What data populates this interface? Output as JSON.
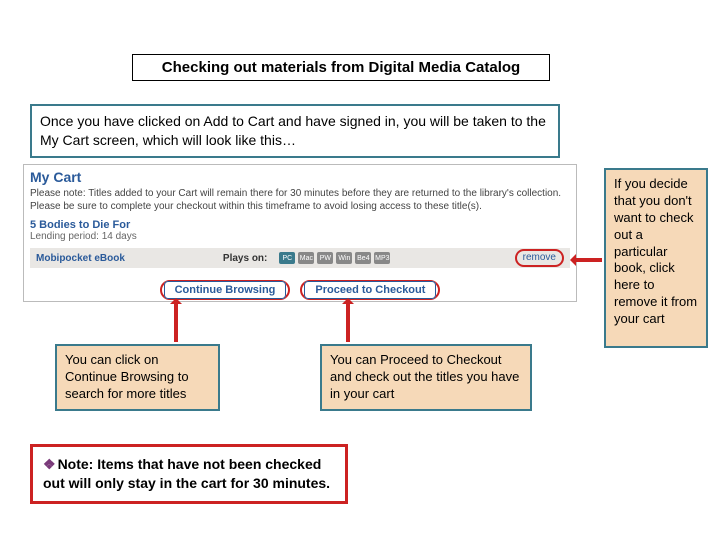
{
  "title": "Checking out materials from Digital Media Catalog",
  "intro": "Once you have clicked on Add to Cart and have signed in, you will be taken to the My Cart screen, which will look like this…",
  "cart": {
    "heading": "My Cart",
    "note": "Please note: Titles added to your Cart will remain there for 30 minutes before they are returned to the library's collection. Please be sure to complete your checkout within this timeframe to avoid losing access to these title(s).",
    "item_title": "5 Bodies to Die For",
    "lending_period": "Lending period: 14 days",
    "format_label": "Mobipocket eBook",
    "plays_on_label": "Plays on:",
    "badges": [
      "PC",
      "Mac",
      "PW",
      "Win",
      "Be4",
      "MP3"
    ],
    "remove_label": "remove",
    "continue_label": "Continue Browsing",
    "proceed_label": "Proceed to Checkout"
  },
  "callout_side": "If you decide that you don't want to check out a particular book, click here to remove it from your cart",
  "callout_left": "You can click on Continue Browsing to search for more titles",
  "callout_mid": "You can Proceed to Checkout  and check out the titles you have in your cart",
  "note": {
    "bullet": "❖",
    "lead": "Note:",
    "body": " Items that have not been checked out will only stay in the cart for 30 minutes."
  }
}
